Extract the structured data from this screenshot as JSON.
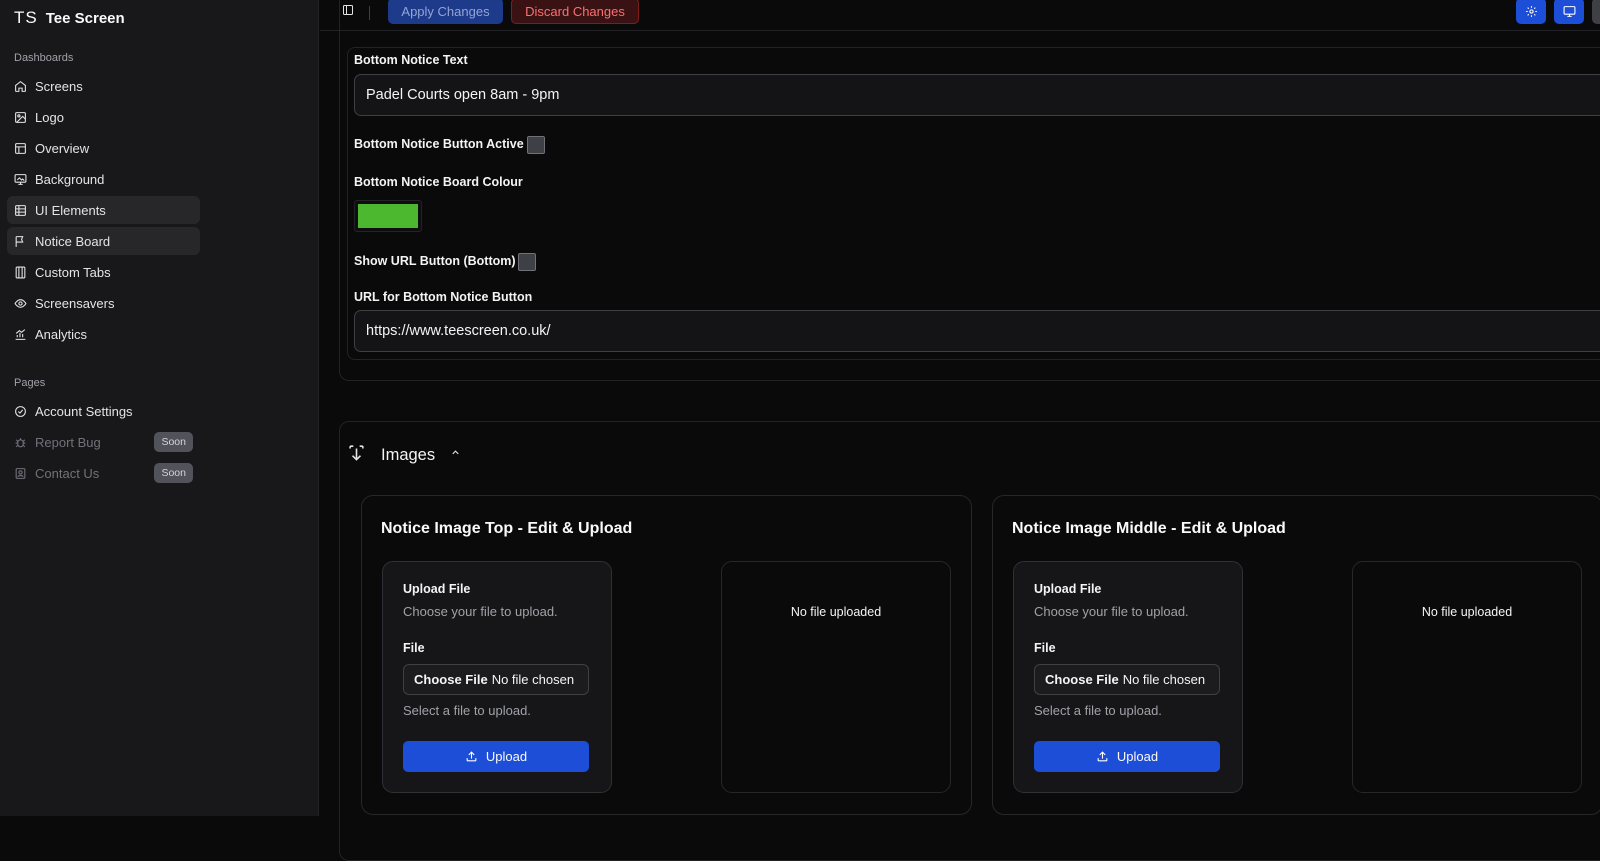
{
  "brand": {
    "logo": "TS",
    "name": "Tee Screen"
  },
  "sidebar": {
    "dashboards_label": "Dashboards",
    "items": [
      {
        "label": "Screens",
        "icon": "home-icon"
      },
      {
        "label": "Logo",
        "icon": "image-edit-icon"
      },
      {
        "label": "Overview",
        "icon": "layout-icon"
      },
      {
        "label": "Background",
        "icon": "monitor-image-icon"
      },
      {
        "label": "UI Elements",
        "icon": "table-icon"
      },
      {
        "label": "Notice Board",
        "icon": "flag-icon"
      },
      {
        "label": "Custom Tabs",
        "icon": "columns-icon"
      },
      {
        "label": "Screensavers",
        "icon": "eye-icon"
      },
      {
        "label": "Analytics",
        "icon": "chart-icon"
      }
    ],
    "pages_label": "Pages",
    "pages": [
      {
        "label": "Account Settings",
        "icon": "check-circle-icon"
      },
      {
        "label": "Report Bug",
        "icon": "bug-icon",
        "badge": "Soon"
      },
      {
        "label": "Contact Us",
        "icon": "contact-icon",
        "badge": "Soon"
      }
    ]
  },
  "toolbar": {
    "apply_label": "Apply Changes",
    "discard_label": "Discard Changes"
  },
  "notice": {
    "bottom_text_label": "Bottom Notice Text",
    "bottom_text_value": "Padel Courts open 8am - 9pm",
    "button_active_label": "Bottom Notice Button Active",
    "board_colour_label": "Bottom Notice Board Colour",
    "board_colour": "#4cb82f",
    "show_url_label": "Show URL Button (Bottom)",
    "url_label": "URL for Bottom Notice Button",
    "url_value": "https://www.teescreen.co.uk/"
  },
  "images": {
    "title": "Images",
    "cards": [
      {
        "title": "Notice Image Top - Edit & Upload",
        "upload_title": "Upload File",
        "upload_desc": "Choose your file to upload.",
        "file_label": "File",
        "file_button": "Choose File",
        "file_status": "No file chosen",
        "hint": "Select a file to upload.",
        "upload_button": "Upload",
        "preview": "No file uploaded"
      },
      {
        "title": "Notice Image Middle - Edit & Upload",
        "upload_title": "Upload File",
        "upload_desc": "Choose your file to upload.",
        "file_label": "File",
        "file_button": "Choose File",
        "file_status": "No file chosen",
        "hint": "Select a file to upload.",
        "upload_button": "Upload",
        "preview": "No file uploaded"
      }
    ]
  },
  "colors": {
    "accent": "#1d4ed8",
    "danger": "#f87171",
    "sidebar_bg": "#18181b",
    "page_bg": "#0a0a0b"
  }
}
